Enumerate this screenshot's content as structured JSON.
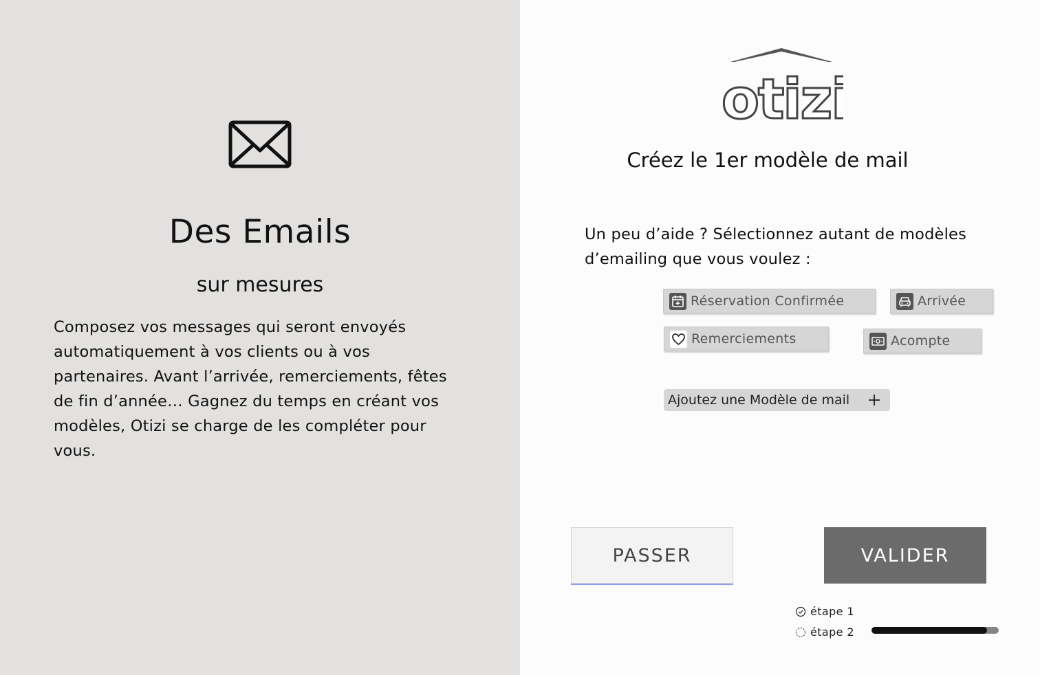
{
  "left": {
    "title": "Des Emails",
    "subtitle": "sur mesures",
    "body": "Composez vos messages qui seront envoyés automatiquement à vos clients ou à vos partenaires. Avant l’arrivée, remerciements, fêtes de fin d’année… Gagnez du temps en créant vos modèles, Otizi se charge de les compléter pour vous."
  },
  "right": {
    "brand": "otizi",
    "title": "Créez le 1er modèle de mail",
    "help_text": "Un peu d’aide ? Sélectionnez autant de modèles d’emailing que vous voulez :",
    "chips": [
      {
        "label": "Réservation Confirmée",
        "icon": "calendar-icon"
      },
      {
        "label": "Arrivée",
        "icon": "car-icon"
      },
      {
        "label": "Remerciements",
        "icon": "heart-icon"
      },
      {
        "label": "Acompte",
        "icon": "banknote-icon"
      }
    ],
    "add_label": "Ajoutez une Modèle de mail",
    "skip_label": "PASSER",
    "submit_label": "VALIDER",
    "steps": [
      {
        "label": "étape 1",
        "status": "done",
        "icon": "check-circle-icon"
      },
      {
        "label": "étape 2",
        "status": "in-progress",
        "icon": "loading-circle-icon"
      }
    ],
    "progress": 0.91
  },
  "colors": {
    "left_bg": "#e2e1df",
    "right_bg": "#fcfcfc",
    "chip_bg": "#d6d6d6",
    "primary_button": "#6b6b6b",
    "progress_track": "#858585",
    "progress_fill": "#111111"
  }
}
